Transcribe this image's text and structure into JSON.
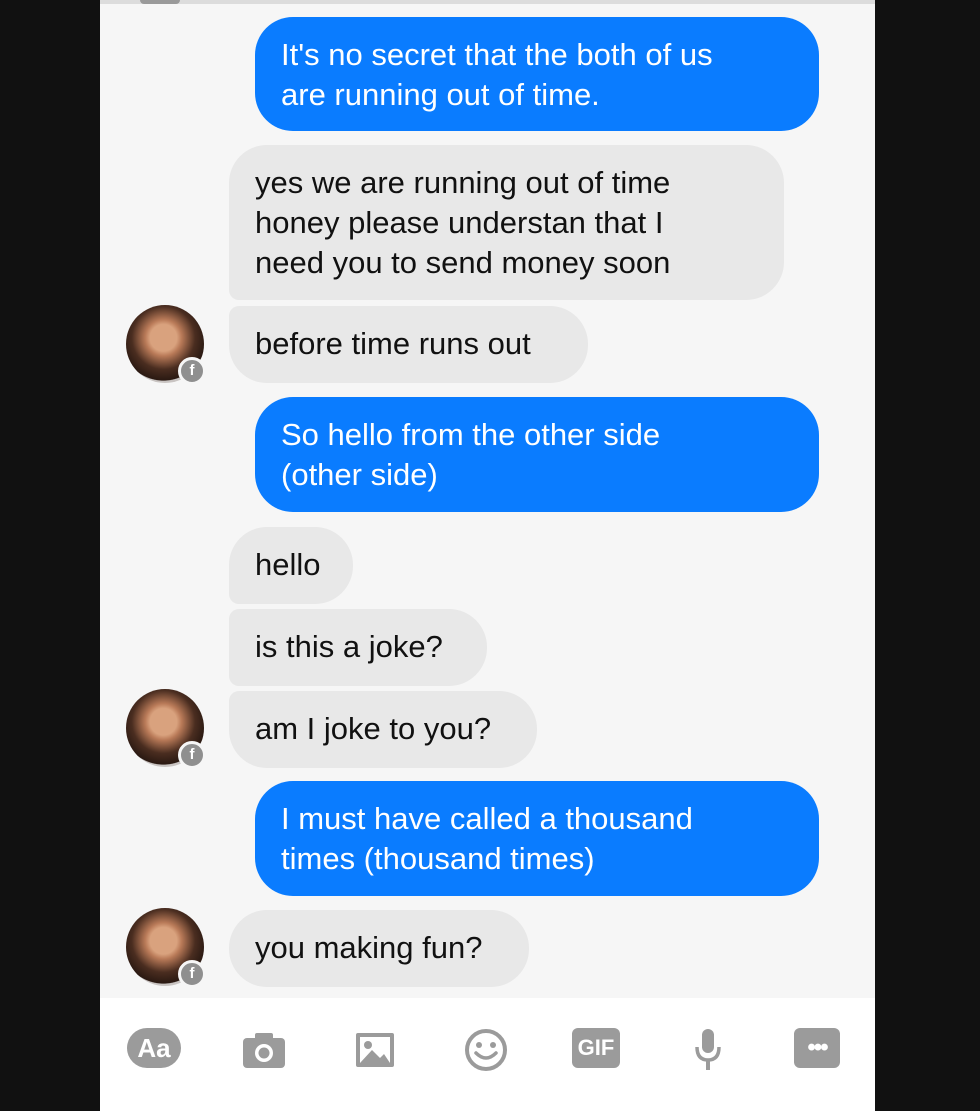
{
  "conversation": {
    "messages": [
      {
        "sender": "me",
        "text": "It's no secret that the both of us\nare running out of time."
      },
      {
        "sender": "them",
        "text": "yes we are running out of time\nhoney please understan that I\nneed you to send money soon"
      },
      {
        "sender": "them",
        "text": "before time runs out"
      },
      {
        "sender": "me",
        "text": "So hello from the other side\n(other side)"
      },
      {
        "sender": "them",
        "text": "hello"
      },
      {
        "sender": "them",
        "text": "is this a joke?"
      },
      {
        "sender": "them",
        "text": "am I joke to you?"
      },
      {
        "sender": "me",
        "text": "I must have called a thousand\ntimes (thousand times)"
      },
      {
        "sender": "them",
        "text": "you making fun?"
      }
    ]
  },
  "composer": {
    "text_button_label": "Aa",
    "gif_button_label": "GIF",
    "more_button_label": "•••",
    "icons": [
      "text-icon",
      "camera-icon",
      "image-icon",
      "emoji-icon",
      "gif-icon",
      "microphone-icon",
      "more-icon"
    ]
  },
  "colors": {
    "sent_bubble": "#0a7cff",
    "received_bubble": "#e8e8e8",
    "icon_gray": "#9b9b9b",
    "background": "#f6f6f6"
  }
}
